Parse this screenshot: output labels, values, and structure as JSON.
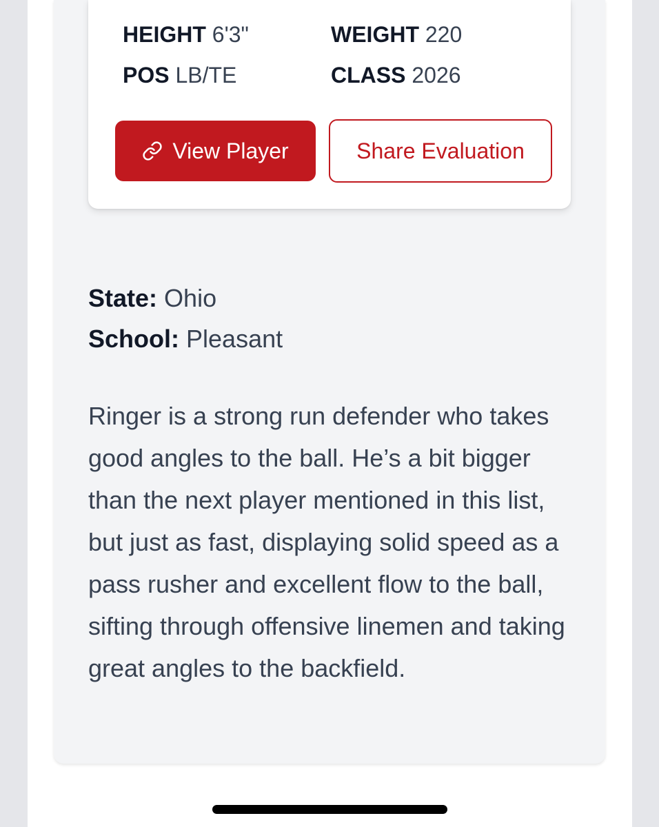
{
  "player": {
    "height_label": "HEIGHT",
    "height_value": "6'3\"",
    "weight_label": "WEIGHT",
    "weight_value": "220",
    "pos_label": "POS",
    "pos_value": "LB/TE",
    "class_label": "CLASS",
    "class_value": "2026"
  },
  "actions": {
    "view_player": "View Player",
    "share_evaluation": "Share Evaluation"
  },
  "details": {
    "state_label": "State:",
    "state_value": "Ohio",
    "school_label": "School:",
    "school_value": "Pleasant"
  },
  "evaluation": {
    "text": "Ringer is a strong run defender who takes good angles to the ball. He’s a bit bigger than the next player mentioned in this list, but just as fast, displaying solid speed as a pass rusher and excellent flow to the ball, sifting through offensive linemen and taking great angles to the backfield."
  },
  "colors": {
    "accent": "#c1191f",
    "page_bg": "#e5e6ea",
    "section_bg": "#f3f4f6",
    "text_dark": "#111827",
    "text_body": "#374151"
  },
  "icons": {
    "view_player_icon": "link-icon"
  }
}
